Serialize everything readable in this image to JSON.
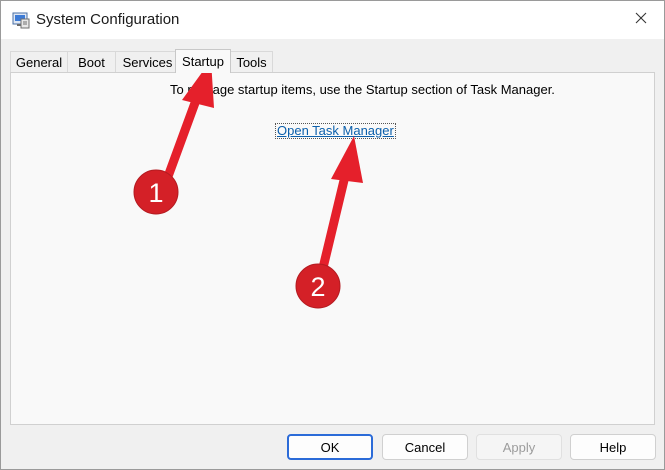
{
  "window": {
    "title": "System Configuration",
    "icon": "msconfig-icon",
    "close_icon": "close-icon"
  },
  "tabs": [
    {
      "label": "General",
      "active": false
    },
    {
      "label": "Boot",
      "active": false
    },
    {
      "label": "Services",
      "active": false
    },
    {
      "label": "Startup",
      "active": true
    },
    {
      "label": "Tools",
      "active": false
    }
  ],
  "startup": {
    "info_text": "To manage startup items, use the Startup section of Task Manager.",
    "link_label": "Open Task Manager"
  },
  "buttons": {
    "ok": "OK",
    "cancel": "Cancel",
    "apply": "Apply",
    "help": "Help"
  },
  "annotations": {
    "color": "#e5202b",
    "badges": [
      "1",
      "2"
    ]
  }
}
